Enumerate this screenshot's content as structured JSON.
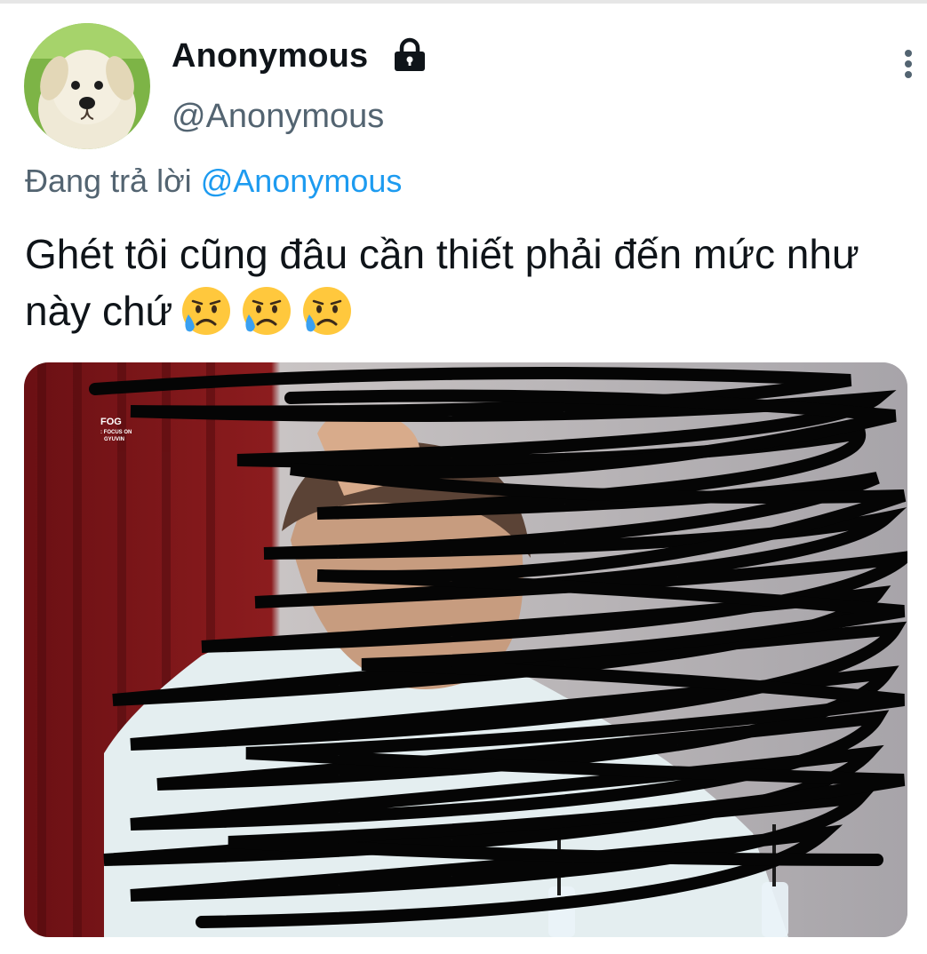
{
  "tweet": {
    "display_name": "Anonymous",
    "handle": "@Anonymous",
    "protected_icon": "lock-icon",
    "more_icon": "more-vertical-icon",
    "avatar": "puppy-avatar",
    "reply_prefix": "Đang trả lời",
    "reply_to": "@Anonymous",
    "text": "Ghét tôi cũng đâu cần thiết phải đến mức như này chứ",
    "emojis": [
      "sad-but-relieved-face-icon",
      "sad-but-relieved-face-icon",
      "sad-but-relieved-face-icon"
    ],
    "media": {
      "watermark_title": "FOG",
      "watermark_subtitle": ": FOCUS ON",
      "watermark_name": "GYUVIN"
    }
  },
  "colors": {
    "text_primary": "#0f1419",
    "text_secondary": "#536471",
    "link": "#1d9bf0",
    "scribble": "#050505"
  }
}
